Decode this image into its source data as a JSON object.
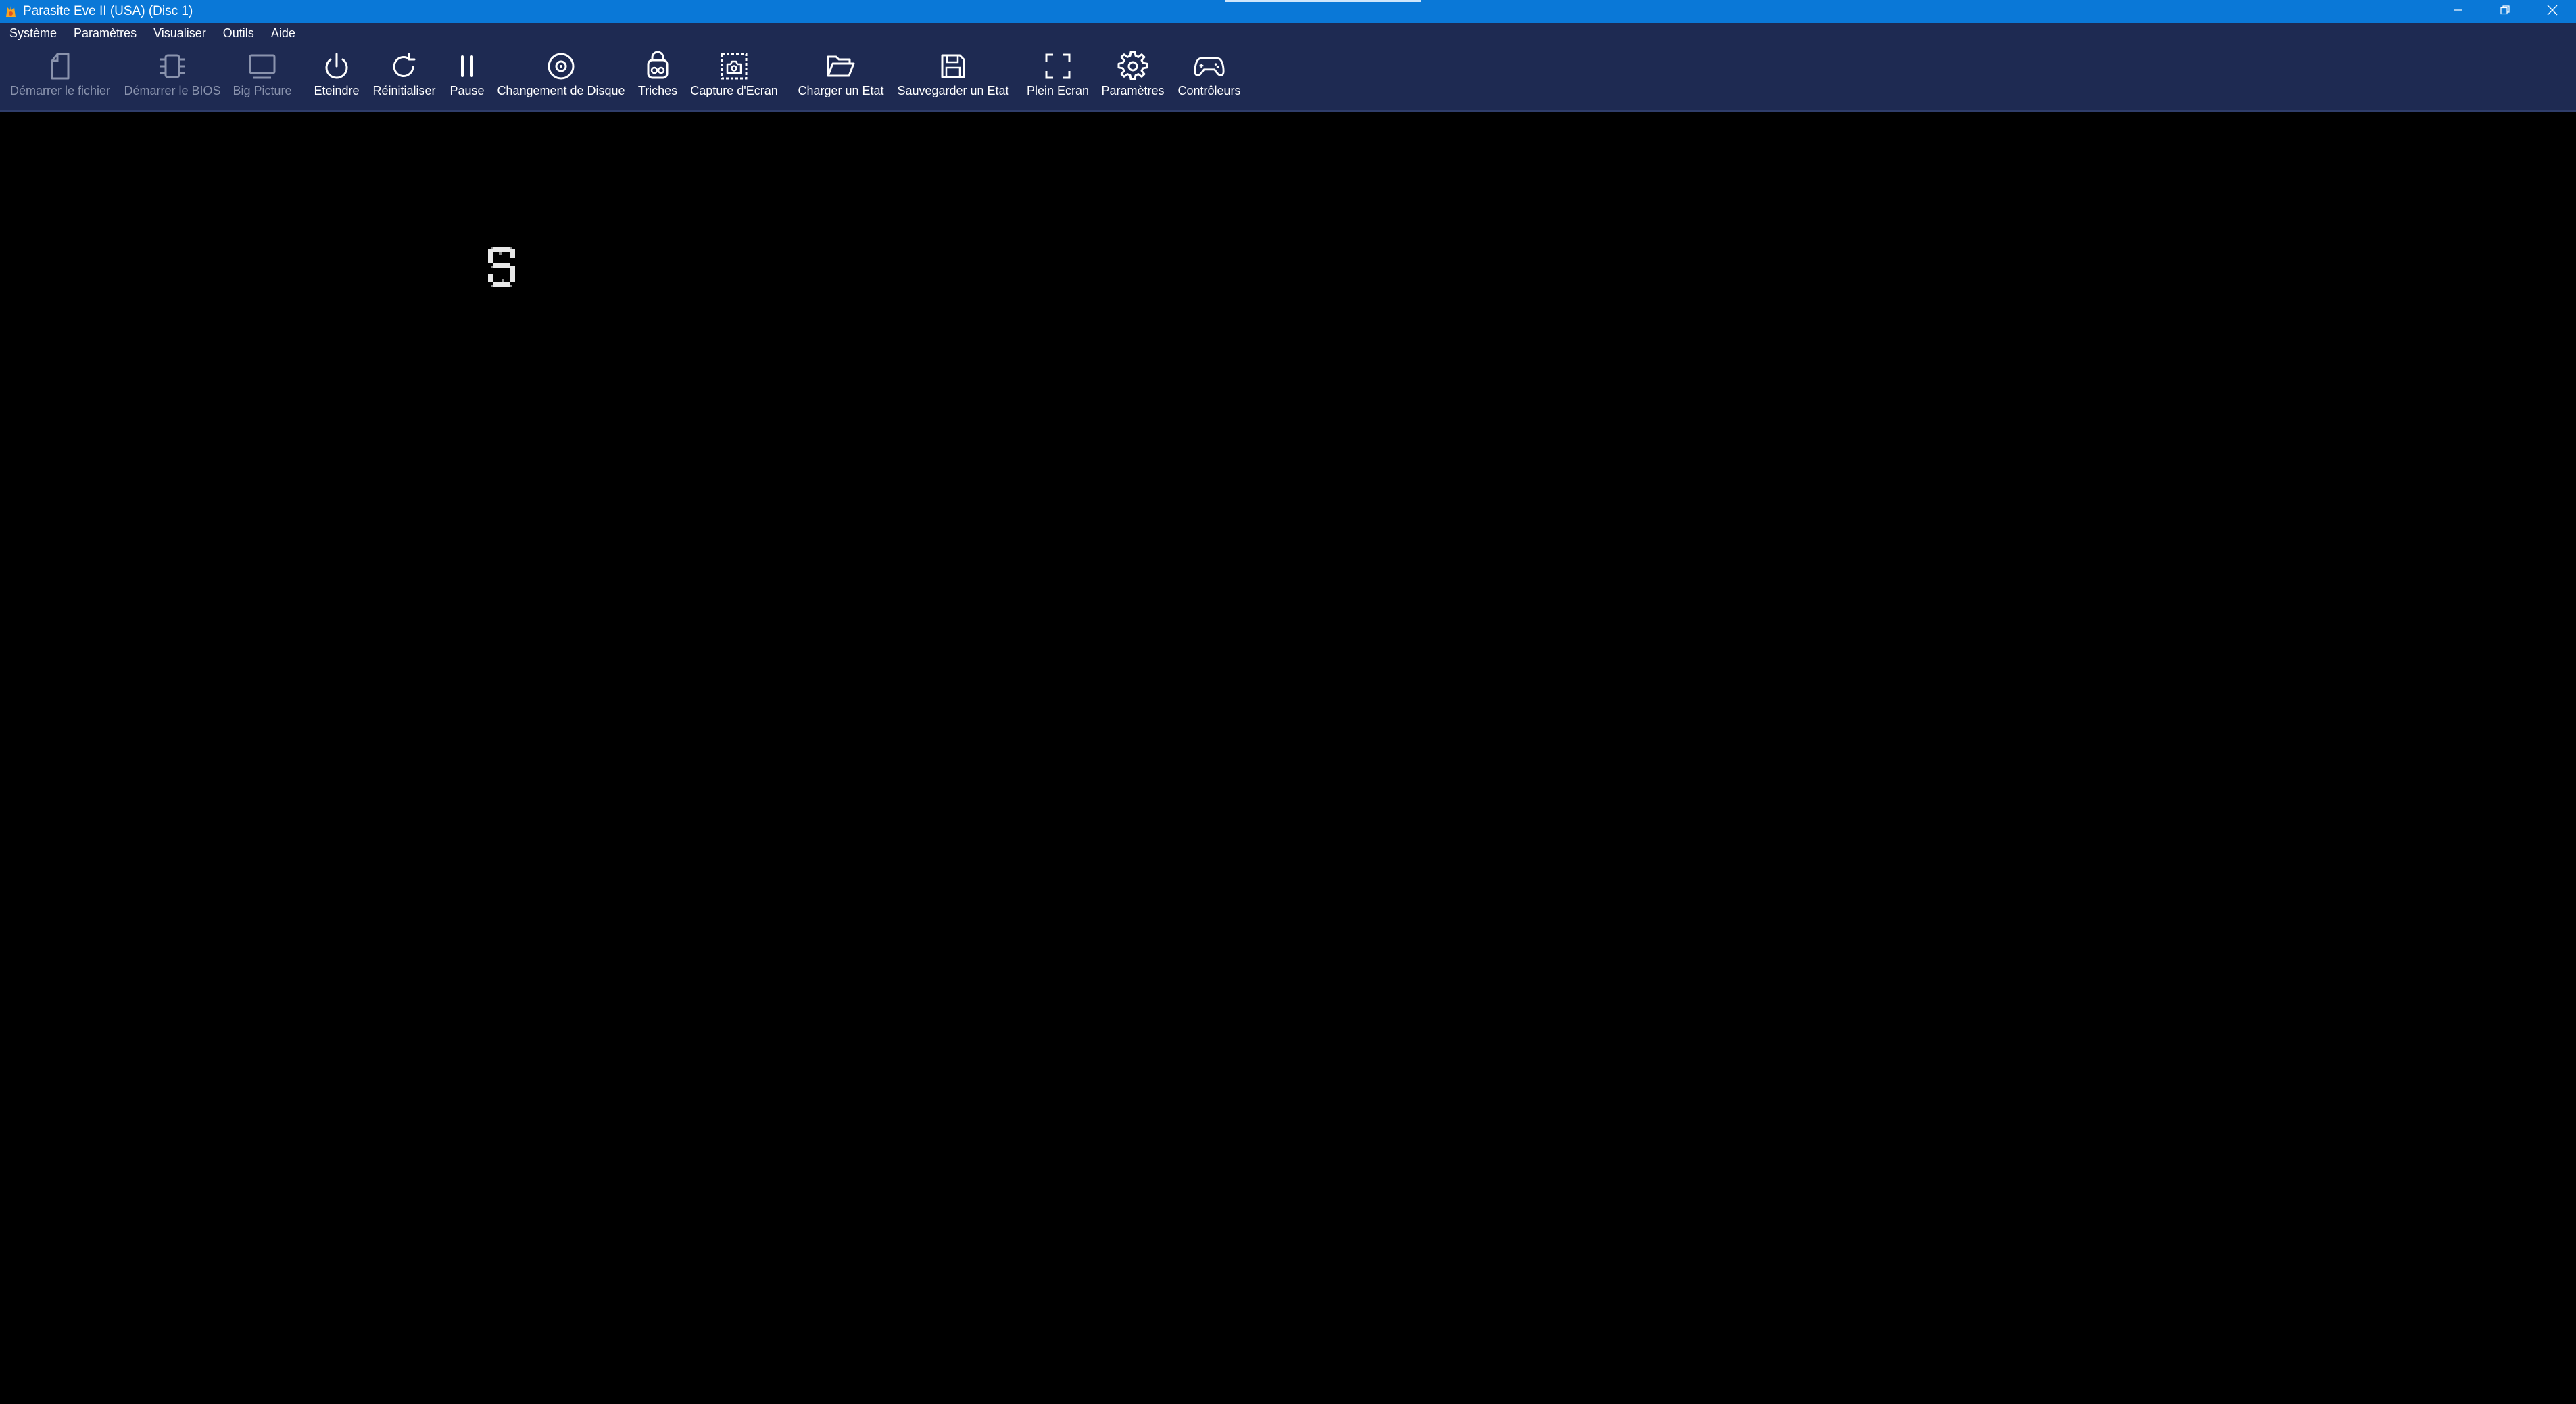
{
  "window": {
    "title": "Parasite Eve II (USA) (Disc 1)",
    "accent_color": "#0a78d7",
    "app_icon": "duckstation-app-icon",
    "controls": [
      "minimize-icon",
      "restore-icon",
      "close-icon"
    ]
  },
  "menubar": {
    "items": [
      {
        "label": "Système"
      },
      {
        "label": "Paramètres"
      },
      {
        "label": "Visualiser"
      },
      {
        "label": "Outils"
      },
      {
        "label": "Aide"
      }
    ]
  },
  "toolbar": {
    "background": "#1e2a52",
    "items": [
      {
        "label": "Démarrer le fichier",
        "icon": "file-icon",
        "enabled": false
      },
      {
        "label": "Démarrer le BIOS",
        "icon": "chip-icon",
        "enabled": false
      },
      {
        "label": "Big Picture",
        "icon": "monitor-icon",
        "enabled": false
      },
      {
        "label": "Eteindre",
        "icon": "power-icon",
        "enabled": true
      },
      {
        "label": "Réinitialiser",
        "icon": "reset-icon",
        "enabled": true
      },
      {
        "label": "Pause",
        "icon": "pause-icon",
        "enabled": true
      },
      {
        "label": "Changement de Disque",
        "icon": "disc-icon",
        "enabled": true
      },
      {
        "label": "Triches",
        "icon": "cheat-icon",
        "enabled": true
      },
      {
        "label": "Capture d'Ecran",
        "icon": "screenshot-icon",
        "enabled": true
      },
      {
        "label": "Charger un Etat",
        "icon": "folder-open-icon",
        "enabled": true
      },
      {
        "label": "Sauvegarder un Etat",
        "icon": "save-icon",
        "enabled": true
      },
      {
        "label": "Plein Ecran",
        "icon": "fullscreen-icon",
        "enabled": true
      },
      {
        "label": "Paramètres",
        "icon": "gear-icon",
        "enabled": true
      },
      {
        "label": "Contrôleurs",
        "icon": "gamepad-icon",
        "enabled": true
      }
    ]
  },
  "viewport": {
    "background": "#000000",
    "content": "game-loading-glyph"
  }
}
